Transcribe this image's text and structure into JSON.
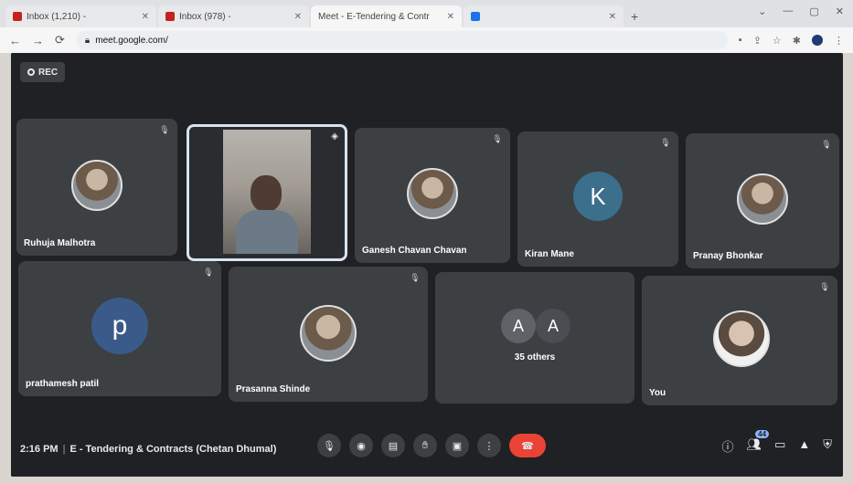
{
  "browser": {
    "tabs": [
      {
        "label": "Inbox (1,210) - ",
        "favicon": "gmail-icon"
      },
      {
        "label": "Inbox (978) - ",
        "favicon": "gmail-icon"
      },
      {
        "label": "Meet - E-Tendering & Contr",
        "favicon": "meet-icon"
      },
      {
        "label": "",
        "favicon": "doc-icon"
      }
    ],
    "url": "meet.google.com/"
  },
  "meet": {
    "rec_label": "REC",
    "participants": [
      {
        "name": "Ruhuja Malhotra",
        "avatar": "photo"
      },
      {
        "name": "",
        "avatar": "video"
      },
      {
        "name": "Ganesh Chavan Chavan",
        "avatar": "photo"
      },
      {
        "name": "Kiran Mane",
        "avatar": "letter",
        "letter": "K",
        "color": "#3b6f8c"
      },
      {
        "name": "Pranay Bhonkar",
        "avatar": "photo"
      },
      {
        "name": "prathamesh patil",
        "avatar": "letter",
        "letter": "p",
        "color": "#3a5a8a"
      },
      {
        "name": "Prasanna Shinde",
        "avatar": "photo"
      },
      {
        "name": "You",
        "avatar": "photo"
      }
    ],
    "others": {
      "letters": [
        "A",
        "A"
      ],
      "label": "35 others"
    },
    "time": "2:16 PM",
    "meeting_title": "E - Tendering & Contracts (Chetan Dhumal)",
    "participants_badge": "44"
  }
}
